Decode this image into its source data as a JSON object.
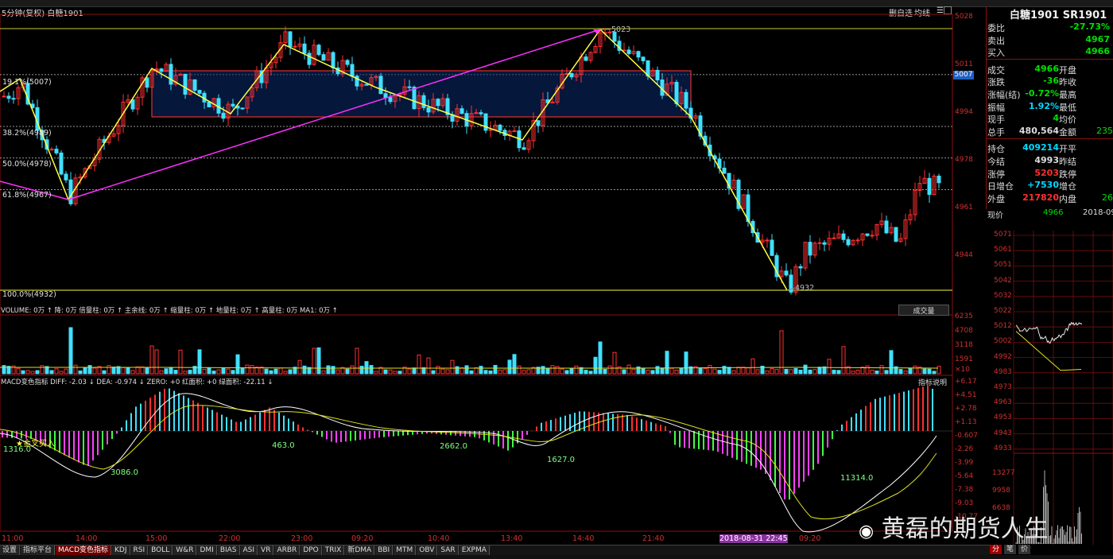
{
  "window": {
    "timeframe": "5分钟(复权)",
    "symbol": "白糖1901"
  },
  "toolbar": {
    "draw_label": "删自选",
    "ma_label": "均线",
    "settings": "☰"
  },
  "fib_levels": [
    {
      "label": "19.1%(5007)",
      "price": 5007
    },
    {
      "label": "38.2%(4989)",
      "price": 4989
    },
    {
      "label": "50.0%(4978)",
      "price": 4978
    },
    {
      "label": "61.8%(4967)",
      "price": 4967
    },
    {
      "label": "100.0%(4932)",
      "price": 4932
    }
  ],
  "price_axis": [
    "5028",
    "5011",
    "4994",
    "4978",
    "4961",
    "4944"
  ],
  "current_price_tag": "5007",
  "pivots": {
    "high": "5023",
    "low": "4932"
  },
  "volume_header": {
    "text": "VOLUME: 0万 ↑ 降: 0万 倍量柱: 0万 ↑ 主余线: 0万 ↑ 缩量柱: 0万 ↑ 地量柱: 0万 ↑ 高量柱: 0万 MA1: 0万 ↑",
    "button": "成交量"
  },
  "volume_axis": [
    "6235",
    "4708",
    "3118",
    "1591",
    "×10"
  ],
  "macd_header": {
    "text": "MACD变色指标 DIFF: -2.03 ↓ DEA: -0.974 ↓ ZERO: +0 红面积: +0 绿面积: -22.11 ↓",
    "button": "指标说明"
  },
  "macd_axis": [
    "+6.17",
    "+4.51",
    "+2.78",
    "+1.13",
    "-0.607",
    "-2.26",
    "-3.99",
    "-5.64",
    "-7.38",
    "-9.03",
    "-10.77"
  ],
  "macd_labels": [
    "1316.0",
    "3086.0",
    "463.0",
    "2662.0",
    "1627.0",
    "11314.0",
    "金叉买入"
  ],
  "time_axis": [
    "11:00",
    "14:00",
    "15:00",
    "22:00",
    "23:00",
    "09:20",
    "10:40",
    "13:40",
    "14:40",
    "21:40",
    "2018-08-31 22:45",
    "09:20"
  ],
  "tabs": [
    "设置",
    "指标平台",
    "MACD变色指标",
    "KDJ",
    "RSI",
    "BOLL",
    "W&R",
    "DMI",
    "BIAS",
    "ASI",
    "VR",
    "ARBR",
    "DPO",
    "TRIX",
    "新DMA",
    "BBI",
    "MTM",
    "OBV",
    "SAR",
    "EXPMA"
  ],
  "active_tab": "MACD变色指标",
  "quote": {
    "title": "白糖1901 SR1901",
    "rows": [
      {
        "l": "委比",
        "v": "-27.73%",
        "c": "#00e000"
      },
      {
        "l": "卖出",
        "v": "4967",
        "c": "#00e000"
      },
      {
        "l": "买入",
        "v": "4966",
        "c": "#00e000"
      },
      {
        "l": "成交",
        "v": "4966",
        "c": "#00e000",
        "l2": "开盘",
        "v2": ""
      },
      {
        "l": "涨跌",
        "v": "-36",
        "c": "#00e000",
        "l2": "昨收",
        "v2": ""
      },
      {
        "l": "涨幅(结)",
        "v": "-0.72%",
        "c": "#00e000",
        "l2": "最高",
        "v2": ""
      },
      {
        "l": "振幅",
        "v": "1.92%",
        "c": "#00d8ff",
        "l2": "最低",
        "v2": ""
      },
      {
        "l": "现手",
        "v": "4",
        "c": "#00e000",
        "l2": "均价",
        "v2": ""
      },
      {
        "l": "总手",
        "v": "480,564",
        "c": "#dddddd",
        "l2": "金额",
        "v2": "235"
      },
      {
        "l": "持仓",
        "v": "409214",
        "c": "#00d8ff",
        "l2": "开平",
        "v2": ""
      },
      {
        "l": "今结",
        "v": "4993",
        "c": "#dddddd",
        "l2": "昨结",
        "v2": ""
      },
      {
        "l": "涨停",
        "v": "5203",
        "c": "#ff3030",
        "l2": "跌停",
        "v2": ""
      },
      {
        "l": "日增仓",
        "v": "+7530",
        "c": "#00d8ff",
        "l2": "增仓",
        "v2": ""
      },
      {
        "l": "外盘",
        "v": "217820",
        "c": "#ff3030",
        "l2": "内盘",
        "v2": "26"
      }
    ],
    "now_label": "现价",
    "now_value": "4966",
    "date": "2018-09-"
  },
  "mini_axis": [
    "5071",
    "5061",
    "5051",
    "5042",
    "5032",
    "5022",
    "5012",
    "5002",
    "4992",
    "4983",
    "4973",
    "4963",
    "4953",
    "4943",
    "4933"
  ],
  "mini_vol_axis": [
    "13277",
    "9958",
    "6638"
  ],
  "right_tabs": [
    "分",
    "笔",
    "价"
  ],
  "watermark": "黄磊的期货人生",
  "colors": {
    "up": "#ff3030",
    "down": "#40e0ff",
    "fib": "#c8c832",
    "zig": "#ffff40",
    "trend": "#ff30ff"
  }
}
